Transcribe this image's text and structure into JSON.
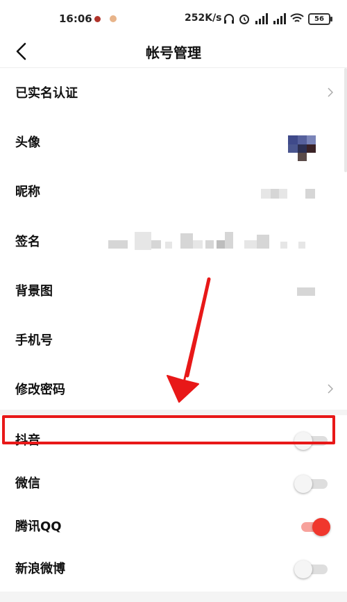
{
  "status_bar": {
    "time": "16:06",
    "network_speed": "252K/s",
    "battery": "56"
  },
  "header": {
    "title": "帐号管理"
  },
  "rows": [
    {
      "label": "已实名认证"
    },
    {
      "label": "头像"
    },
    {
      "label": "昵称"
    },
    {
      "label": "签名"
    },
    {
      "label": "背景图"
    },
    {
      "label": "手机号"
    },
    {
      "label": "修改密码"
    }
  ],
  "bindings": [
    {
      "label": "抖音",
      "enabled": false
    },
    {
      "label": "微信",
      "enabled": false
    },
    {
      "label": "腾讯QQ",
      "enabled": true
    },
    {
      "label": "新浪微博",
      "enabled": false
    }
  ],
  "colors": {
    "highlight": "#e81818",
    "toggle_on": "#f0372d",
    "toggle_off": "#dedede"
  }
}
